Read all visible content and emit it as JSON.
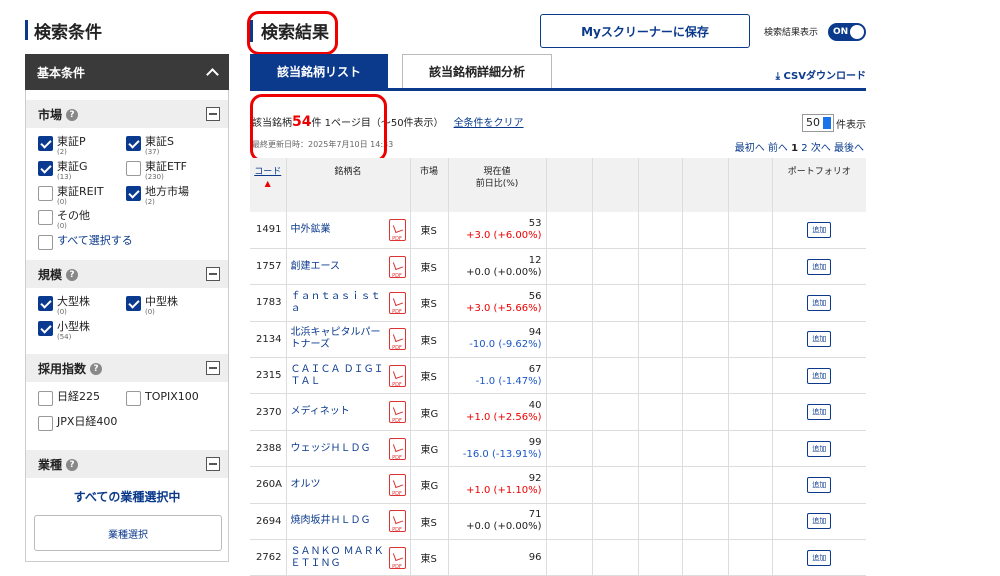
{
  "sidebar": {
    "title": "検索条件",
    "basic_label": "基本条件",
    "market": {
      "label": "市場",
      "items": [
        {
          "label": "東証P",
          "count": "(2)",
          "checked": true
        },
        {
          "label": "東証S",
          "count": "(37)",
          "checked": true
        },
        {
          "label": "東証G",
          "count": "(13)",
          "checked": true
        },
        {
          "label": "東証ETF",
          "count": "(230)",
          "checked": false
        },
        {
          "label": "東証REIT",
          "count": "(0)",
          "checked": false
        },
        {
          "label": "地方市場",
          "count": "(2)",
          "checked": true
        },
        {
          "label": "その他",
          "count": "(0)",
          "checked": false
        }
      ],
      "select_all": "すべて選択する"
    },
    "scale": {
      "label": "規模",
      "items": [
        {
          "label": "大型株",
          "count": "(0)",
          "checked": true
        },
        {
          "label": "中型株",
          "count": "(0)",
          "checked": true
        },
        {
          "label": "小型株",
          "count": "(54)",
          "checked": true
        }
      ]
    },
    "index": {
      "label": "採用指数",
      "items": [
        {
          "label": "日経225",
          "checked": false
        },
        {
          "label": "TOPIX100",
          "checked": false
        },
        {
          "label": "JPX日経400",
          "checked": false
        }
      ]
    },
    "industry": {
      "label": "業種",
      "all_selected": "すべての業種選択中",
      "button": "業種選択"
    }
  },
  "main": {
    "title": "検索結果",
    "save_button": "Myスクリーナーに保存",
    "toggle_label": "検索結果表示",
    "toggle_value": "ON",
    "tabs": [
      "該当銘柄リスト",
      "該当銘柄詳細分析"
    ],
    "csv": "CSVダウンロード",
    "hits_prefix": "該当銘柄",
    "hits_count": "54",
    "hits_suffix": "件 1ページ目（〜50件表示）",
    "clear_link": "全条件をクリア",
    "updated": "最終更新日時：2025年7月10日 14:33",
    "per_page_value": "50",
    "per_page_suffix": "件表示",
    "pager": {
      "first": "最初へ",
      "prev": "前へ",
      "p1": "1",
      "p2": "2",
      "next": "次へ",
      "last": "最後へ"
    },
    "columns": {
      "code": "コード",
      "name": "銘柄名",
      "market": "市場",
      "price1": "現在値",
      "price2": "前日比(%)",
      "portfolio": "ポートフォリオ"
    },
    "sort_arrow": "▲",
    "add_label": "追加",
    "pdf_label": "PDF",
    "rows": [
      {
        "code": "1491",
        "name": "中外鉱業",
        "market": "東S",
        "price": "53",
        "change": "+3.0 (+6.00%)",
        "dir": "up"
      },
      {
        "code": "1757",
        "name": "創建エース",
        "market": "東S",
        "price": "12",
        "change": "+0.0 (+0.00%)",
        "dir": "flat"
      },
      {
        "code": "1783",
        "name": "ｆａｎｔａｓｉｓｔａ",
        "market": "東S",
        "price": "56",
        "change": "+3.0 (+5.66%)",
        "dir": "up"
      },
      {
        "code": "2134",
        "name": "北浜キャピタルパートナーズ",
        "market": "東S",
        "price": "94",
        "change": "-10.0 (-9.62%)",
        "dir": "dn"
      },
      {
        "code": "2315",
        "name": "ＣＡＩＣＡ ＤＩＧＩＴＡＬ",
        "market": "東S",
        "price": "67",
        "change": "-1.0 (-1.47%)",
        "dir": "dn"
      },
      {
        "code": "2370",
        "name": "メディネット",
        "market": "東G",
        "price": "40",
        "change": "+1.0 (+2.56%)",
        "dir": "up"
      },
      {
        "code": "2388",
        "name": "ウェッジＨＬＤＧ",
        "market": "東G",
        "price": "99",
        "change": "-16.0 (-13.91%)",
        "dir": "dn"
      },
      {
        "code": "260A",
        "name": "オルツ",
        "market": "東G",
        "price": "92",
        "change": "+1.0 (+1.10%)",
        "dir": "up"
      },
      {
        "code": "2694",
        "name": "焼肉坂井ＨＬＤＧ",
        "market": "東S",
        "price": "71",
        "change": "+0.0 (+0.00%)",
        "dir": "flat"
      },
      {
        "code": "2762",
        "name": "ＳＡＮＫＯ ＭＡＲＫＥＴＩＮＧ",
        "market": "東S",
        "price": "96",
        "change": "",
        "dir": "flat"
      }
    ]
  }
}
